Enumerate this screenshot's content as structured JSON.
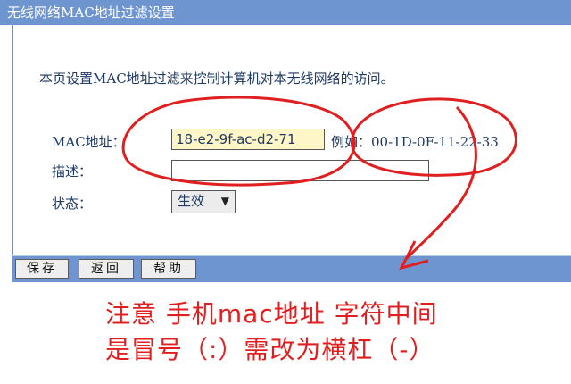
{
  "window": {
    "title": "无线网络MAC地址过滤设置"
  },
  "intro": "本页设置MAC地址过滤来控制计算机对本无线网络的访问。",
  "form": {
    "mac_label": "MAC地址：",
    "mac_value": "18-e2-9f-ac-d2-71",
    "example": "例如：00-1D-0F-11-22-33",
    "desc_label": "描述：",
    "desc_value": "",
    "status_label": "状态：",
    "status_value": "生效"
  },
  "buttons": {
    "save": "保存",
    "back": "返回",
    "help": "帮助"
  },
  "annotation": {
    "line1": "注意 手机mac地址 字符中间",
    "line2": "是冒号（:）需改为横杠（-）",
    "color": "#e02020"
  },
  "colors": {
    "header": "#6e95cf",
    "text": "#1f3a63",
    "input_highlight": "#fff6c8"
  }
}
